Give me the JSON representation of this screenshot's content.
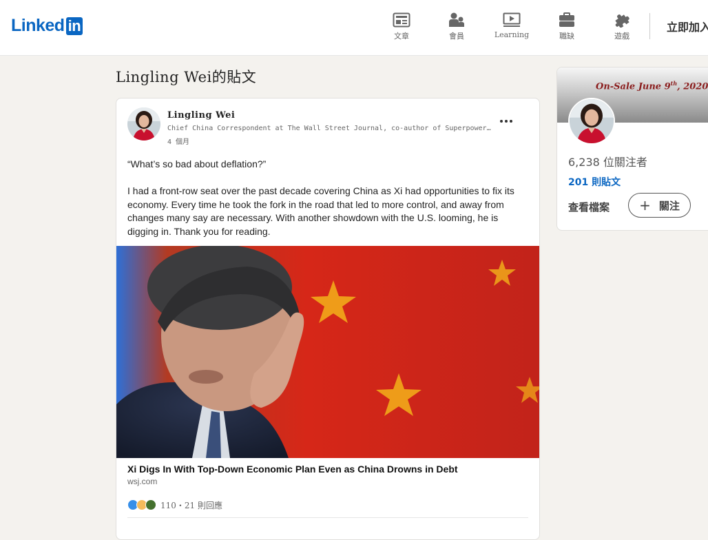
{
  "nav": {
    "brand_text": "Linked",
    "brand_in": "in",
    "items": [
      {
        "label": "文章",
        "icon": "articles-icon"
      },
      {
        "label": "會員",
        "icon": "people-icon"
      },
      {
        "label": "Learning",
        "icon": "learning-icon"
      },
      {
        "label": "職缺",
        "icon": "jobs-icon"
      },
      {
        "label": "遊戲",
        "icon": "games-icon"
      }
    ],
    "join_label": "立即加入"
  },
  "page": {
    "title": "Lingling Wei的貼文"
  },
  "post": {
    "author_name": "Lingling Wei",
    "author_headline": "Chief China Correspondent at The Wall Street Journal, co-author of Superpower Showdown",
    "age": "4 個月",
    "quote": "“What’s so bad about deflation?”",
    "body": "I had a front-row seat over the past decade covering China as Xi had opportunities to fix its economy. Every time he took the fork in the road that led to more control, and away from changes many say are necessary. With another showdown with the U.S. looming, he is digging in. Thank you for reading.",
    "article_title": "Xi Digs In With Top-Down Economic Plan Even as China Drowns in Debt",
    "article_source": "wsj.com",
    "reaction_summary": "110・21 則回應",
    "reaction_icons": [
      "like-icon",
      "insightful-icon",
      "support-icon"
    ]
  },
  "profile_card": {
    "banner_text": "On-Sale June 9",
    "banner_sup": "th",
    "banner_year": ", 2020",
    "followers": "6,238 位關注者",
    "posts_link": "201 則貼文",
    "view_profile": "查看檔案",
    "follow_label": "關注"
  },
  "colors": {
    "brand": "#0a66c2",
    "page_bg": "#f4f2ee",
    "flag_red": "#d62718",
    "flag_star": "#f3b21a"
  }
}
